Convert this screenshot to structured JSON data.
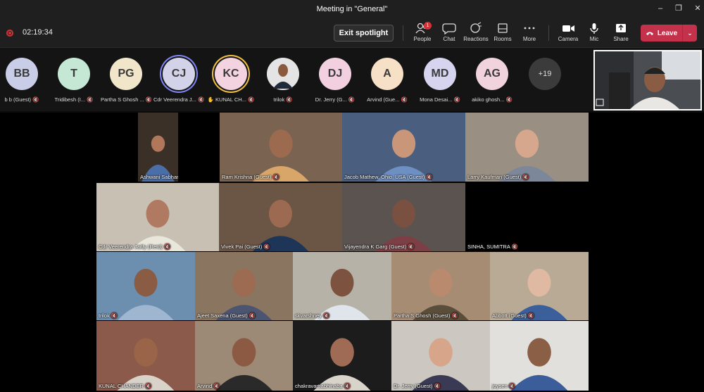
{
  "window": {
    "title": "Meeting in \"General\"",
    "min_icon": "minimize-icon",
    "max_icon": "restore-icon",
    "close_icon": "close-icon"
  },
  "toolbar": {
    "timer": "02:19:34",
    "spotlight_label": "Exit spotlight",
    "people_label": "People",
    "people_badge": "1",
    "chat_label": "Chat",
    "reactions_label": "Reactions",
    "rooms_label": "Rooms",
    "more_label": "More",
    "camera_label": "Camera",
    "mic_label": "Mic",
    "share_label": "Share",
    "leave_label": "Leave",
    "accent": "#c4314b"
  },
  "attendees": [
    {
      "initials": "BB",
      "name": "b b (Guest)",
      "color": "#c9cde8"
    },
    {
      "initials": "T",
      "name": "Tridibesh (I...",
      "color": "#c5e8d4"
    },
    {
      "initials": "PG",
      "name": "Partha S Ghosh ...",
      "color": "#f1e6c9"
    },
    {
      "initials": "CJ",
      "name": "Cdr Veerendra J...",
      "color": "#d2d3e8"
    },
    {
      "initials": "KC",
      "name": "KUNAL CH...",
      "color": "#f3d3e0"
    },
    {
      "initials": "",
      "name": "trilok",
      "color": "#4a4a4a"
    },
    {
      "initials": "DJ",
      "name": "Dr. Jerry (G...",
      "color": "#f3d0df"
    },
    {
      "initials": "A",
      "name": "Arvind (Gue...",
      "color": "#f6e0c6"
    },
    {
      "initials": "MD",
      "name": "Mona Desai...",
      "color": "#d6d4ee"
    },
    {
      "initials": "AG",
      "name": "akiko ghosh...",
      "color": "#f0d3dc"
    },
    {
      "initials": "+19",
      "name": "",
      "color": "#3b3b3b"
    }
  ],
  "tiles": [
    {
      "name": "Ashwani Sabharwal",
      "bg": "#3b3028"
    },
    {
      "name": "Ram Krishna (Guest)",
      "bg": "#7a6451"
    },
    {
      "name": "Jacob Mathew, Ohio, USA (Guest)",
      "bg": "#4a5f80"
    },
    {
      "name": "Larry Kaufman (Guest)",
      "bg": "#9a8f83"
    },
    {
      "name": "Cdr Veerendra Jaitly (Retd)",
      "bg": "#c8c0b3"
    },
    {
      "name": "Vivek Pai (Guest)",
      "bg": "#6b5646"
    },
    {
      "name": "Vijayendra K Garg (Guest)",
      "bg": "#5b5350"
    },
    {
      "name": "SINHA, SUMITRA",
      "bg": "#000000"
    },
    {
      "name": "trilok",
      "bg": "#6c8fb0"
    },
    {
      "name": "Ajeet Saxena (Guest)",
      "bg": "#8a7560"
    },
    {
      "name": "skvarshney",
      "bg": "#b7b2a8"
    },
    {
      "name": "Partha S Ghosh (Guest)",
      "bg": "#a68c73"
    },
    {
      "name": "Abbott (Guest)",
      "bg": "#b9aa96"
    },
    {
      "name": "KUNAL CHANDER",
      "bg": "#8b5a4a"
    },
    {
      "name": "Arvind",
      "bg": "#9c8a76"
    },
    {
      "name": "chakravartiabhinaba",
      "bg": "#1c1c1c"
    },
    {
      "name": "Dr. Jerry (Guest)",
      "bg": "#ccc8c1"
    },
    {
      "name": "joysen",
      "bg": "#e2e0dc"
    }
  ]
}
